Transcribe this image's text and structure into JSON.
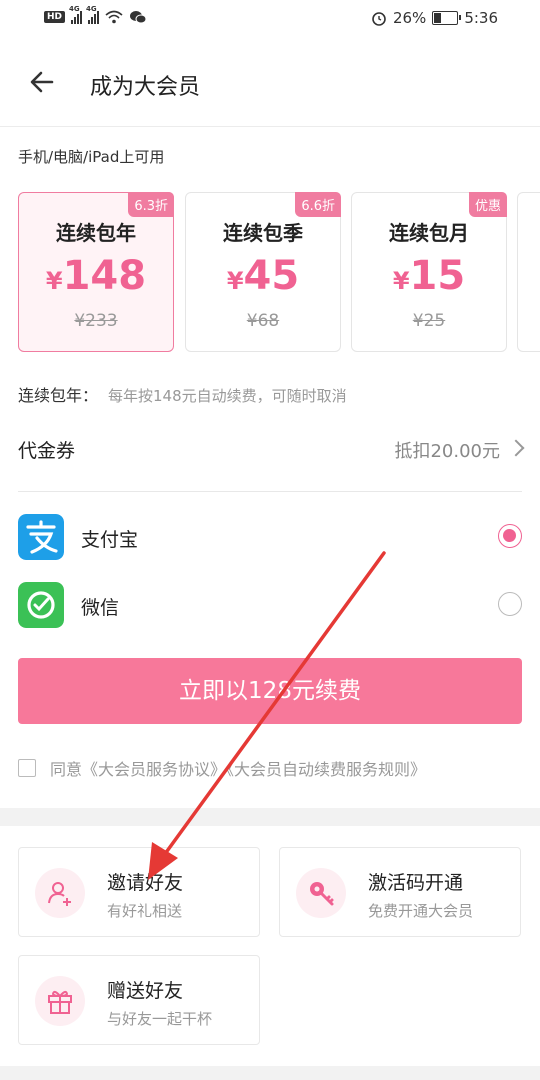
{
  "status": {
    "hd": "HD",
    "signal1": "4G",
    "signal2": "4G",
    "battery_percent": "26%",
    "battery_level": 0.26,
    "time": "5:36"
  },
  "header": {
    "title": "成为大会员",
    "back_icon": "arrow-left-icon"
  },
  "availability": "手机/电脑/iPad上可用",
  "plans": [
    {
      "badge": "6.3折",
      "name": "连续包年",
      "currency": "¥",
      "price": "148",
      "original": "¥233",
      "selected": true
    },
    {
      "badge": "6.6折",
      "name": "连续包季",
      "currency": "¥",
      "price": "45",
      "original": "¥68",
      "selected": false
    },
    {
      "badge": "优惠",
      "name": "连续包月",
      "currency": "¥",
      "price": "15",
      "original": "¥25",
      "selected": false
    }
  ],
  "renewal": {
    "label": "连续包年：",
    "desc": "每年按148元自动续费，可随时取消"
  },
  "voucher": {
    "label": "代金券",
    "value": "抵扣20.00元"
  },
  "payment": [
    {
      "name": "支付宝",
      "icon": "alipay-icon",
      "color": "#1E9FE8",
      "selected": true
    },
    {
      "name": "微信",
      "icon": "wechat-icon",
      "color": "#3BC156",
      "selected": false
    }
  ],
  "cta": {
    "label": "立即以128元续费"
  },
  "agreement": "同意《大会员服务协议》《大会员自动续费服务规则》",
  "cards": [
    {
      "title": "邀请好友",
      "subtitle": "有好礼相送",
      "icon": "add-user-icon"
    },
    {
      "title": "激活码开通",
      "subtitle": "免费开通大会员",
      "icon": "key-icon"
    },
    {
      "title": "赠送好友",
      "subtitle": "与好友一起干杯",
      "icon": "gift-icon"
    }
  ],
  "colors": {
    "accent": "#F06292",
    "cta": "#F7789A",
    "annotation_arrow": "#E53935"
  }
}
